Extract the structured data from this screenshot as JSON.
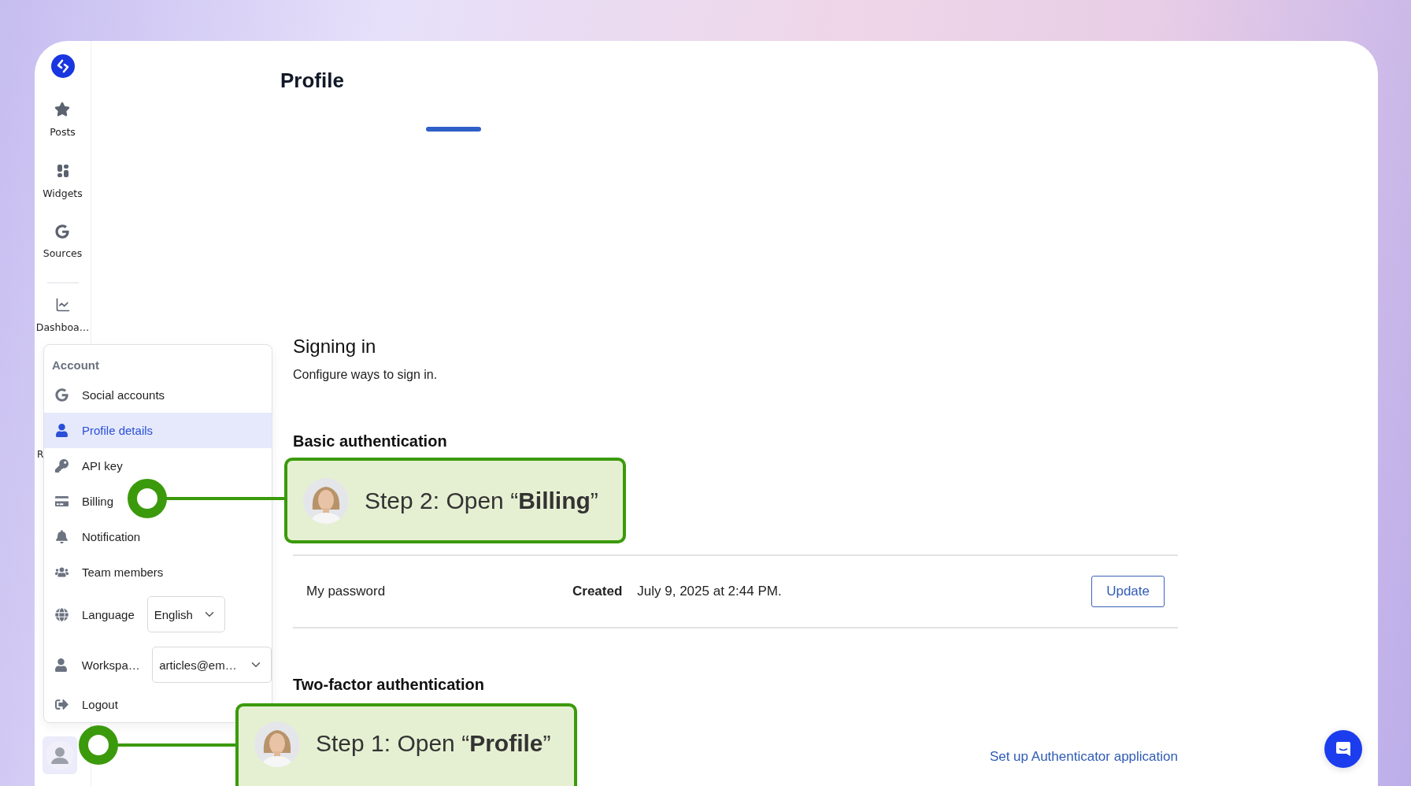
{
  "sidebar": {
    "nav_groups": [
      [
        {
          "label": "Posts"
        },
        {
          "label": "Widgets"
        },
        {
          "label": "Sources"
        }
      ],
      [
        {
          "label": "Dashboa…"
        }
      ]
    ],
    "partial_label": "R"
  },
  "account_menu": {
    "heading": "Account",
    "items": [
      {
        "label": "Social accounts",
        "selected": false
      },
      {
        "label": "Profile details",
        "selected": true
      },
      {
        "label": "API key",
        "selected": false
      },
      {
        "label": "Billing",
        "selected": false
      },
      {
        "label": "Notification",
        "selected": false
      },
      {
        "label": "Team members",
        "selected": false
      }
    ],
    "language": {
      "label": "Language",
      "value": "English"
    },
    "workspace": {
      "label": "Workspa…",
      "value": "articles@em…"
    },
    "logout": "Logout"
  },
  "page": {
    "title": "Profile",
    "signing_in": {
      "title": "Signing in",
      "description": "Configure ways to sign in."
    },
    "basic_auth": {
      "title": "Basic authentication",
      "password_row": {
        "name": "My password",
        "created_label": "Created",
        "created_value": "July 9, 2025 at 2:44 PM.",
        "button": "Update"
      }
    },
    "two_factor": {
      "title": "Two-factor authentication",
      "link": "Set up Authenticator application"
    }
  },
  "callouts": [
    {
      "text": "Step 2: Open “**Billing**”"
    },
    {
      "text": "Step 1: Open “**Profile**”"
    }
  ]
}
